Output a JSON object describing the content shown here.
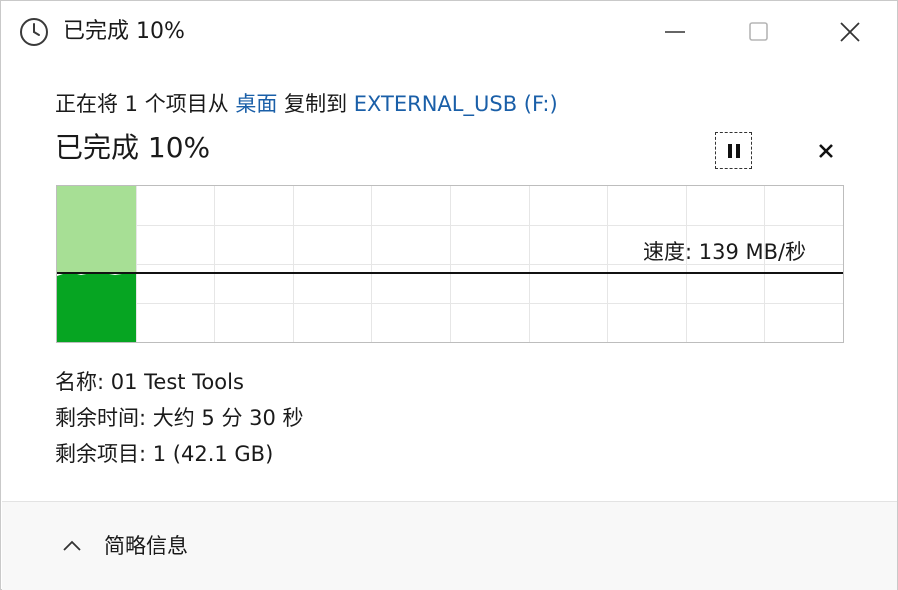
{
  "window": {
    "title": "已完成 10%",
    "icon": "clock-icon",
    "controls": {
      "minimize": "minimize-icon",
      "maximize": "maximize-icon",
      "close": "close-icon"
    }
  },
  "copy": {
    "prefix": "正在将 1 个项目从 ",
    "source": "桌面",
    "middle": " 复制到 ",
    "destination": "EXTERNAL_USB (F:)",
    "link_color": "#1a5fa8"
  },
  "progress": {
    "title": "已完成 10%",
    "percent": 10,
    "pause_icon": "pause-icon",
    "cancel_icon": "cancel-icon"
  },
  "speed": {
    "label": "速度: 139 MB/秒"
  },
  "graph": {
    "fill_light": "#a7df95",
    "fill_dark": "#06a522",
    "grid_color": "#e6e6e6",
    "speed_line_color": "#111111"
  },
  "details": {
    "name": "名称: 01 Test Tools",
    "time_remaining": "剩余时间: 大约 5 分 30 秒",
    "items_remaining": "剩余项目: 1 (42.1 GB)"
  },
  "footer": {
    "toggle_label": "简略信息",
    "toggle_icon": "chevron-up-icon"
  }
}
